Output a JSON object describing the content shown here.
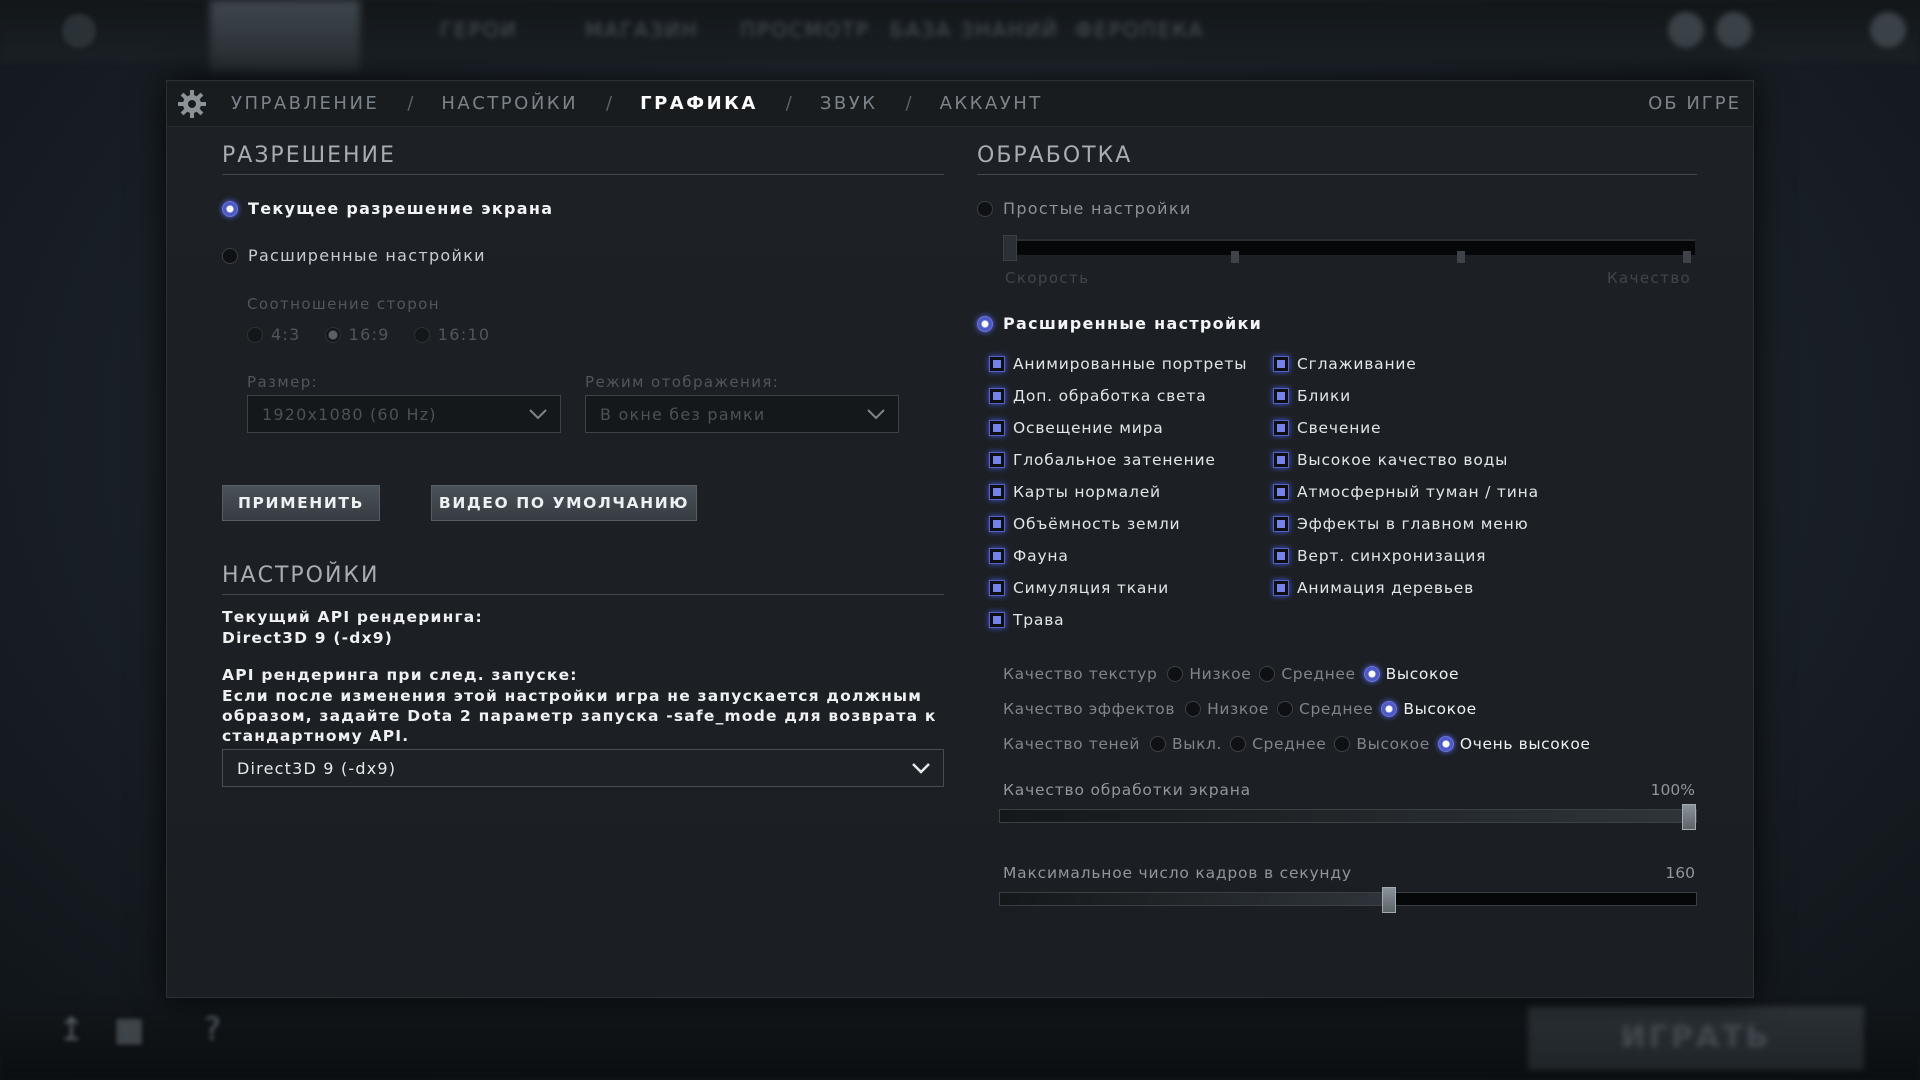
{
  "tabs": {
    "items": [
      "УПРАВЛЕНИЕ",
      "НАСТРОЙКИ",
      "ГРАФИКА",
      "ЗВУК",
      "АККАУНТ"
    ],
    "active": "ГРАФИКА",
    "separator": "/",
    "about": "ОБ ИГРЕ"
  },
  "resolution": {
    "title": "РАЗРЕШЕНИЕ",
    "current_label": "Текущее разрешение экрана",
    "advanced_label": "Расширенные настройки",
    "aspect_title": "Соотношение сторон",
    "aspect_options": [
      "4:3",
      "16:9",
      "16:10"
    ],
    "aspect_selected": "16:9",
    "size_label": "Размер:",
    "size_value": "1920x1080 (60 Hz)",
    "display_label": "Режим отображения:",
    "display_value": "В окне без рамки",
    "apply_button": "ПРИМЕНИТЬ",
    "default_button": "ВИДЕО ПО УМОЛЧАНИЮ"
  },
  "settings": {
    "title": "НАСТРОЙКИ",
    "current_api_label": "Текущий API рендеринга:",
    "current_api_value": "Direct3D 9 (-dx9)",
    "next_api_label": "API рендеринга при след. запуске:",
    "next_api_note_1": "Если после изменения этой настройки игра не запускается должным",
    "next_api_note_2": "образом, задайте Dota 2 параметр запуска -safe_mode для возврата к",
    "next_api_note_3": "стандартному API.",
    "api_dropdown": "Direct3D 9 (-dx9)"
  },
  "processing": {
    "title": "ОБРАБОТКА",
    "simple_label": "Простые настройки",
    "speed_label": "Скорость",
    "quality_label": "Качество",
    "advanced_label": "Расширенные настройки",
    "checks_left": [
      "Анимированные портреты",
      "Доп. обработка света",
      "Освещение мира",
      "Глобальное затенение",
      "Карты нормалей",
      "Объёмность земли",
      "Фауна",
      "Симуляция ткани",
      "Трава"
    ],
    "checks_right": [
      "Сглаживание",
      "Блики",
      "Свечение",
      "Высокое качество воды",
      "Атмосферный туман / тина",
      "Эффекты в главном меню",
      "Верт. синхронизация",
      "Анимация деревьев"
    ],
    "texture": {
      "label": "Качество текстур",
      "options": [
        "Низкое",
        "Среднее",
        "Высокое"
      ],
      "selected": "Высокое"
    },
    "effects": {
      "label": "Качество эффектов",
      "options": [
        "Низкое",
        "Среднее",
        "Высокое"
      ],
      "selected": "Высокое"
    },
    "shadows": {
      "label": "Качество теней",
      "options": [
        "Выкл.",
        "Среднее",
        "Высокое",
        "Очень высокое"
      ],
      "selected": "Очень высокое"
    },
    "screen_quality": {
      "label": "Качество обработки экрана",
      "value_text": "100%",
      "fraction": 1.0
    },
    "max_fps": {
      "label": "Максимальное число кадров в секунду",
      "value_text": "160",
      "fraction": 0.56
    }
  },
  "background": {
    "play_button": "ИГРАТЬ"
  },
  "colors": {
    "accent": "#5b6bff",
    "panel": "#1d2125"
  }
}
